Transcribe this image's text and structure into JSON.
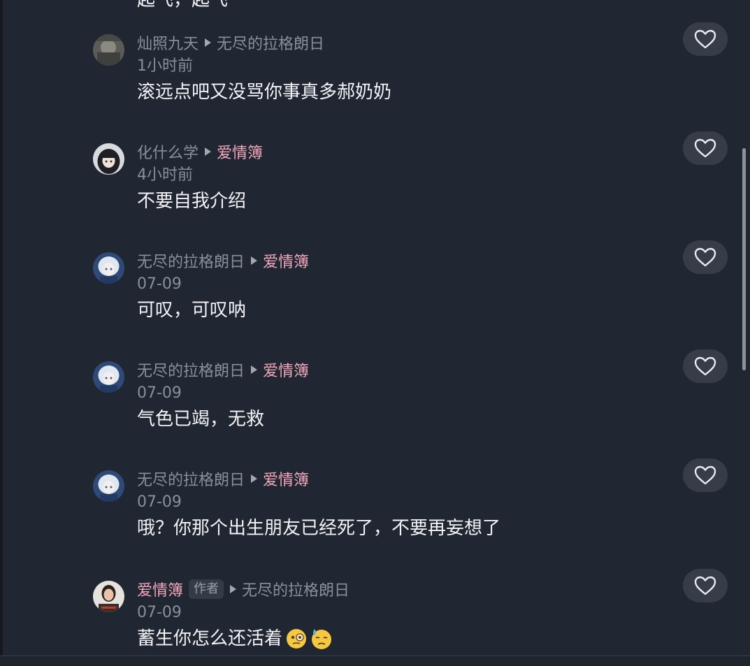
{
  "partial_top_text": "起飞，起飞",
  "comments": [
    {
      "author": "灿照九天",
      "author_is_creator": false,
      "reply_to": "无尽的拉格朗日",
      "reply_to_is_creator": false,
      "time": "1小时前",
      "text": "滚远点吧又没骂你事真多郝奶奶",
      "avatar_icon": "avatar-photo-dark"
    },
    {
      "author": "化什么学",
      "author_is_creator": false,
      "reply_to": "爱情簿",
      "reply_to_is_creator": true,
      "time": "4小时前",
      "text": "不要自我介绍",
      "avatar_icon": "avatar-anime-dark-hair"
    },
    {
      "author": "无尽的拉格朗日",
      "author_is_creator": false,
      "reply_to": "爱情簿",
      "reply_to_is_creator": true,
      "time": "07-09",
      "text": "可叹，可叹呐",
      "avatar_icon": "avatar-anime-white-hair"
    },
    {
      "author": "无尽的拉格朗日",
      "author_is_creator": false,
      "reply_to": "爱情簿",
      "reply_to_is_creator": true,
      "time": "07-09",
      "text": "气色已竭，无救",
      "avatar_icon": "avatar-anime-white-hair"
    },
    {
      "author": "无尽的拉格朗日",
      "author_is_creator": false,
      "reply_to": "爱情簿",
      "reply_to_is_creator": true,
      "time": "07-09",
      "text": "哦？你那个出生朋友已经死了，不要再妄想了",
      "avatar_icon": "avatar-anime-white-hair"
    },
    {
      "author": "爱情簿",
      "author_is_creator": true,
      "author_tag": "作者",
      "reply_to": "无尽的拉格朗日",
      "reply_to_is_creator": false,
      "time": "07-09",
      "text": "蓄生你怎么还活着",
      "emojis": [
        "monocle-face-emoji",
        "sweat-face-emoji"
      ],
      "avatar_icon": "avatar-photo-person"
    }
  ],
  "icons": {
    "like": "heart-outline-icon",
    "reply": "reply-triangle-icon"
  },
  "colors": {
    "background": "#212732",
    "creator_name": "#f1a6ba",
    "secondary_text": "#8a909b",
    "primary_text": "#f2f3f5",
    "like_button_bg": "#373d48"
  }
}
